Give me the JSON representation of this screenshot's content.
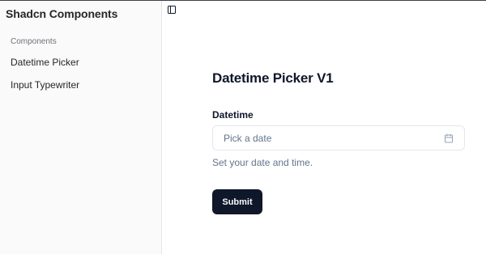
{
  "sidebar": {
    "title": "Shadcn Components",
    "group_label": "Components",
    "items": [
      {
        "label": "Datetime Picker"
      },
      {
        "label": "Input Typewriter"
      }
    ]
  },
  "header": {
    "toggle_icon": "panel-left-icon"
  },
  "form": {
    "title": "Datetime Picker V1",
    "datetime_label": "Datetime",
    "datetime_placeholder": "Pick a date",
    "calendar_icon": "calendar-icon",
    "description": "Set your date and time.",
    "submit_label": "Submit"
  },
  "colors": {
    "primary": "#0f172a",
    "muted_text": "#64748b",
    "sidebar_bg": "#fafafa",
    "border": "#e2e8f0"
  }
}
